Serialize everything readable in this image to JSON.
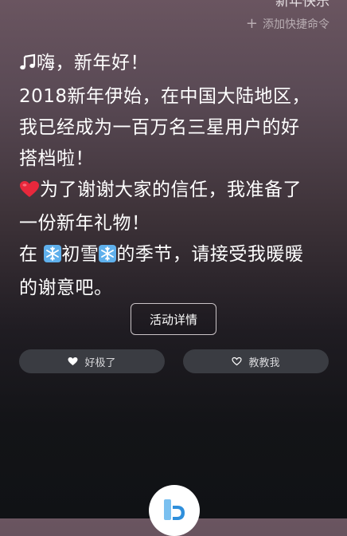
{
  "header": {
    "title": "新年快乐",
    "add_shortcut_label": "添加快捷命令",
    "add_icon": "plus-icon"
  },
  "message": {
    "line1_icon": "music-note-icon",
    "line1": "嗨，新年好！",
    "line2": "2018新年伊始，在中国大陆地区，",
    "line3": "我已经成为一百万名三星用户的好",
    "line4": "搭档啦！",
    "line5_icon": "heart-icon",
    "line5": "为了谢谢大家的信任，我准备了",
    "line6": "一份新年礼物！",
    "line7_a": "在",
    "line7_icon": "snowflake-icon",
    "line7_b": "初雪",
    "line7_c": "的季节，请接受我暖暖",
    "line8": "的谢意吧。"
  },
  "actions": {
    "detail_label": "活动详情",
    "like_label": "好极了",
    "like_icon": "heart-filled-icon",
    "teach_label": "教教我",
    "teach_icon": "heart-outline-icon"
  },
  "assistant": {
    "icon": "bixby-logo-icon"
  },
  "colors": {
    "heart": "#e8283c",
    "snowflake": "#5fb0ec",
    "bixby_blue": "#2f8fdb"
  }
}
